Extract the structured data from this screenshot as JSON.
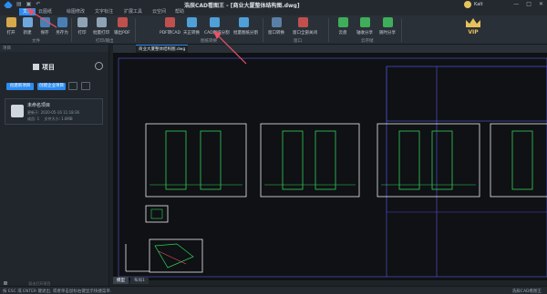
{
  "app": {
    "title": "浩辰CAD看图王 - [商业大厦整体结构图.dwg]",
    "user": "Kalt"
  },
  "menu": {
    "tabs": [
      "文件",
      "云图纸",
      "绘图修改",
      "文字标注",
      "扩展工具",
      "云空间",
      "帮助"
    ],
    "active": "文件"
  },
  "ribbon": {
    "buttons": [
      "打开",
      "新建",
      "保存",
      "另存为",
      "打印",
      "批量打印",
      "输出PDF",
      "PDF转CAD",
      "天正转换",
      "CAD图纸分割",
      "批量图纸分割",
      "窗口转换",
      "窗口全部关闭",
      "云盘",
      "轴收分享",
      "随时分享"
    ],
    "groups": [
      "文件",
      "打印/输出",
      "图纸转换",
      "窗口",
      "云存储"
    ]
  },
  "vip": "VIP",
  "left_panel": {
    "header": "项目",
    "title": "项目",
    "buttons": [
      "创建新项目",
      "创建企业项目"
    ],
    "project": {
      "name": "未命名项目",
      "updated": "更新于: 2020-05-16 11:18:36",
      "members": "成员: 1",
      "size": "文件大小: 1.6MB"
    },
    "footer": "双击打开项目"
  },
  "document": {
    "tab": "商业大厦整体结构图.dwg",
    "layout_tabs": [
      "模型",
      "布局1"
    ],
    "active_layout": "模型"
  },
  "status": {
    "left": "按 ESC 或 ENTER 键退出, 或者单击鼠标右键显示快捷菜单.",
    "right": "浩辰CAD看图王"
  },
  "colors": {
    "accent": "#2d8cf0",
    "annotation": "#e8546a",
    "drawing_green": "#2fd05a",
    "drawing_white": "#e9edf1"
  }
}
